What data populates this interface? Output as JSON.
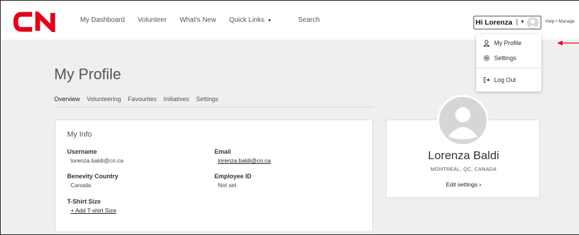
{
  "nav": {
    "items": [
      "My Dashboard",
      "Volunteer",
      "What's New",
      "Quick Links",
      "Search"
    ]
  },
  "user_menu": {
    "greeting": "Hi Lorenza",
    "separator": "|",
    "help_manage": "Help • Manage"
  },
  "dropdown": {
    "items": [
      {
        "label": "My Profile",
        "icon": "user-icon"
      },
      {
        "label": "Settings",
        "icon": "gear-icon"
      },
      {
        "label": "Log Out",
        "icon": "logout-icon"
      }
    ]
  },
  "page": {
    "title": "My Profile",
    "tabs": [
      "Overview",
      "Volunteering",
      "Favourites",
      "Initiatives",
      "Settings"
    ],
    "active_tab": "Overview"
  },
  "info_card": {
    "title": "My Info",
    "username_label": "Username",
    "username_value": "lorenza.baldi@cn.ca",
    "email_label": "Email",
    "email_value": "lorenza.baldi@cn.ca",
    "country_label": "Benevity Country",
    "country_value": "Canada",
    "employee_label": "Employee ID",
    "employee_value": "Not set",
    "tshirt_label": "T-Shirt Size",
    "tshirt_link": "+ Add T-shirt Size"
  },
  "profile_card": {
    "name": "Lorenza Baldi",
    "location": "MONTREAL, QC, CANADA",
    "edit_link": "Edit settings"
  },
  "colors": {
    "brand_red": "#e3001b",
    "annotation_arrow": "#e3001b",
    "page_background": "#efefef"
  }
}
